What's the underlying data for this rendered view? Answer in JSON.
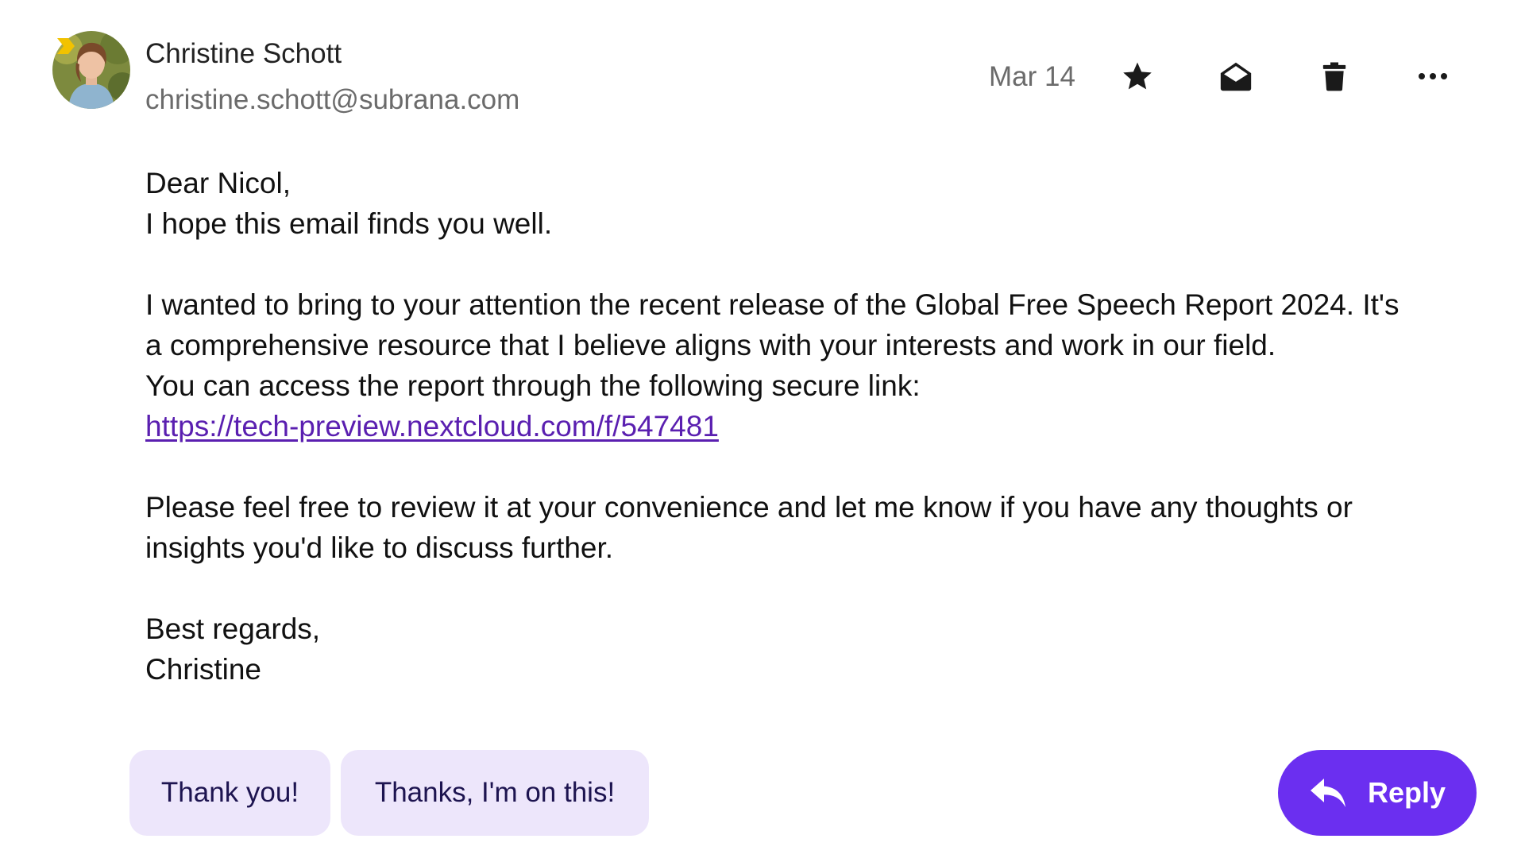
{
  "sender": {
    "name": "Christine Schott",
    "email": "christine.schott@subrana.com",
    "avatar_icon": "avatar-photo",
    "important_marker_color": "#f2c200"
  },
  "date": "Mar 14",
  "toolbar": {
    "star_icon": "star-icon",
    "mark_read_icon": "envelope-open-icon",
    "delete_icon": "trash-icon",
    "more_icon": "more-horizontal-icon"
  },
  "body": {
    "greeting": "Dear Nicol,",
    "line1": "I hope this email finds you well.",
    "para1_line1": "I wanted to bring to your attention the recent release of the Global Free Speech Report 2024. It's",
    "para1_line2": "a comprehensive resource that I believe aligns with your interests and work in our field.",
    "para1_line3": "You can access the report through the following secure link:",
    "link": "https://tech-preview.nextcloud.com/f/547481",
    "para2_line1": "Please feel free to review it at your convenience and let me know if you have any thoughts or",
    "para2_line2": "insights you'd like to discuss further.",
    "closing": "Best regards,",
    "signature": "Christine"
  },
  "quick_replies": [
    {
      "label": "Thank you!"
    },
    {
      "label": "Thanks, I'm on this!"
    }
  ],
  "reply_button": {
    "label": "Reply",
    "icon": "reply-arrow-icon"
  },
  "colors": {
    "accent": "#6b2ff0",
    "suggestion_bg": "#ede6fb",
    "link": "#5a1fb0"
  }
}
